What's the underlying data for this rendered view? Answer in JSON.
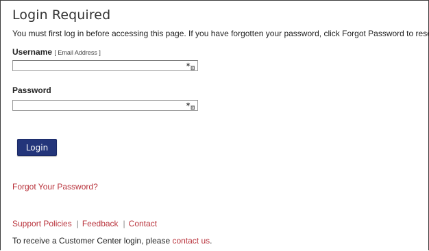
{
  "page": {
    "title": "Login Required",
    "intro": "You must first log in before accessing this page. If you have forgotten your password, click Forgot Password to reset it."
  },
  "form": {
    "username_label": "Username",
    "username_hint": "[ Email Address ]",
    "username_value": "",
    "password_label": "Password",
    "password_value": "",
    "field_icon": "key-badge-icon",
    "login_button": "Login",
    "button_color": "#23357a"
  },
  "links": {
    "forgot_password": "Forgot Your Password?",
    "footer": [
      {
        "label": "Support Policies"
      },
      {
        "label": "Feedback"
      },
      {
        "label": "Contact"
      }
    ],
    "separator": "|",
    "link_color": "#b8313a"
  },
  "footer_note": {
    "prefix": "To receive a Customer Center login, please ",
    "link": "contact us",
    "suffix": "."
  }
}
